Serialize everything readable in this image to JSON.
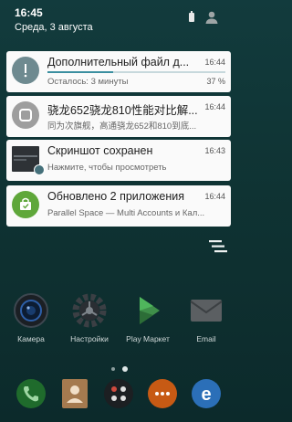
{
  "status_bar": {
    "time": "16:45",
    "date": "Среда, 3 августа"
  },
  "notifications": [
    {
      "title": "Дополнительный файл д...",
      "time": "16:44",
      "text": "Осталось: 3 минуты",
      "progress_percent_label": "37 %",
      "progress": 0.37,
      "icon": "download-icon"
    },
    {
      "title": "骁龙652骁龙810性能对比解...",
      "time": "16:44",
      "text": "同为次旗舰，高通骁龙652和810到底...",
      "icon": "gray-app-icon"
    },
    {
      "title": "Скриншот сохранен",
      "time": "16:43",
      "text": "Нажмите, чтобы просмотреть",
      "icon": "screenshot-thumbnail"
    },
    {
      "title": "Обновлено 2 приложения",
      "time": "16:44",
      "text": "Parallel Space — Multi Accounts и Кал...",
      "icon": "store-update-icon"
    }
  ],
  "apps": [
    {
      "label": "Камера",
      "icon": "camera-icon"
    },
    {
      "label": "Настройки",
      "icon": "settings-icon"
    },
    {
      "label": "Play Маркет",
      "icon": "play-store-icon"
    },
    {
      "label": "Email",
      "icon": "email-icon"
    }
  ],
  "dock": [
    {
      "icon": "phone-icon"
    },
    {
      "icon": "contacts-icon"
    },
    {
      "icon": "app-drawer-icon"
    },
    {
      "icon": "messages-icon"
    },
    {
      "icon": "browser-icon"
    }
  ],
  "colors": {
    "background": "#123b3d",
    "card": "#fafafa",
    "progress": "#3b8fa0",
    "green_badge": "#5fa73a"
  }
}
